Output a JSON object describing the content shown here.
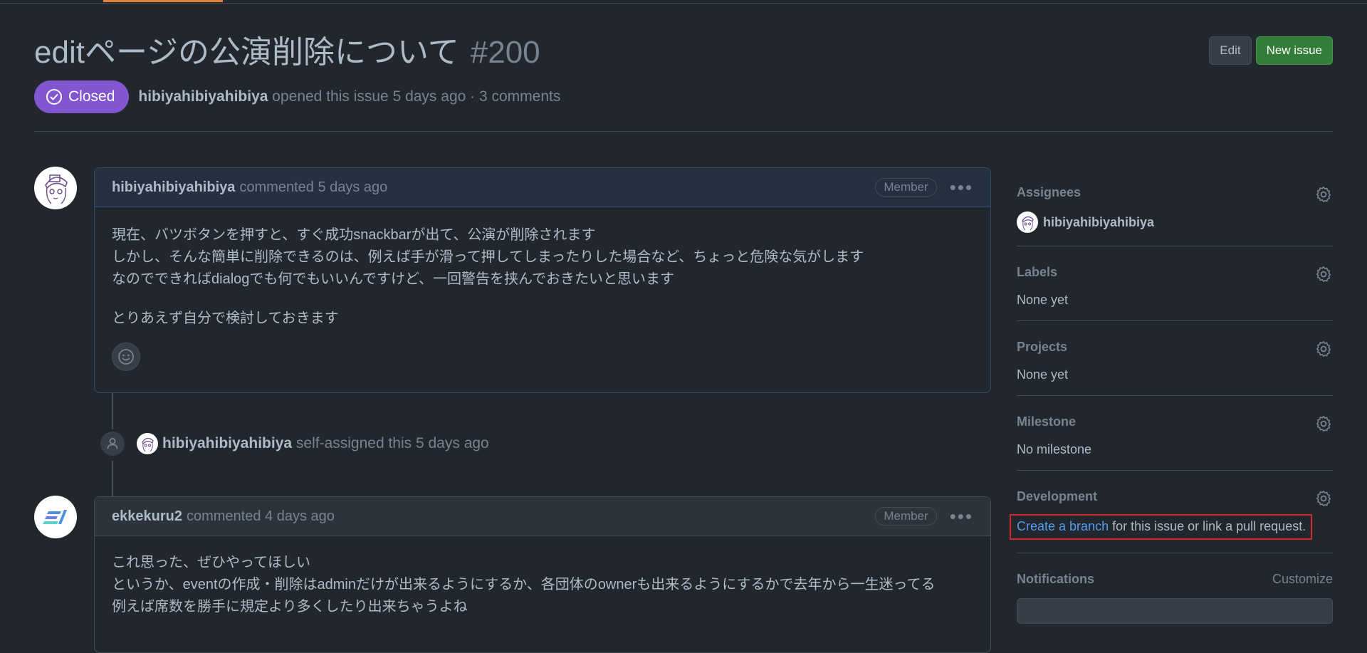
{
  "issue": {
    "title": "editページの公演削除について",
    "number": "#200",
    "state": "Closed",
    "author": "hibiyahibiyahibiya",
    "opened_text": "opened this issue 5 days ago · 3 comments"
  },
  "header_actions": {
    "edit_label": "Edit",
    "new_issue_label": "New issue"
  },
  "comments": [
    {
      "author": "hibiyahibiyahibiya",
      "when": "commented 5 days ago",
      "role": "Member",
      "paragraphs": [
        "現在、バツボタンを押すと、すぐ成功snackbarが出て、公演が削除されます",
        "しかし、そんな簡単に削除できるのは、例えば手が滑って押してしまったりした場合など、ちょっと危険な気がします",
        "なのでできればdialogでも何でもいいんですけど、一回警告を挟んでおきたいと思います",
        "とりあえず自分で検討しておきます"
      ]
    },
    {
      "author": "ekkekuru2",
      "when": "commented 4 days ago",
      "role": "Member",
      "paragraphs": [
        "これ思った、ぜひやってほしい",
        "というか、eventの作成・削除はadminだけが出来るようにするか、各団体のownerも出来るようにするかで去年から一生迷ってる",
        "例えば席数を勝手に規定より多くしたり出来ちゃうよね"
      ]
    }
  ],
  "event": {
    "actor": "hibiyahibiyahibiya",
    "text": "self-assigned this 5 days ago"
  },
  "sidebar": {
    "assignees": {
      "label": "Assignees",
      "user": "hibiyahibiyahibiya"
    },
    "labels": {
      "label": "Labels",
      "value": "None yet"
    },
    "projects": {
      "label": "Projects",
      "value": "None yet"
    },
    "milestone": {
      "label": "Milestone",
      "value": "No milestone"
    },
    "development": {
      "label": "Development",
      "link_text": "Create a branch",
      "rest_text": " for this issue or link a pull request."
    },
    "notifications": {
      "label": "Notifications",
      "customize": "Customize"
    }
  },
  "colors": {
    "background": "#22272e",
    "closed_badge": "#8256d0",
    "new_issue_button": "#347d39",
    "link": "#539bf5",
    "highlight_box": "#d12a2a"
  },
  "icons": [
    "check-circle-icon",
    "kebab-icon",
    "smiley-icon",
    "person-icon",
    "gear-icon"
  ]
}
